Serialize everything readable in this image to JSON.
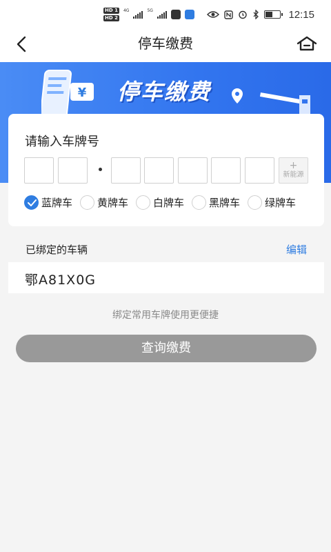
{
  "status_bar": {
    "sim1": "HD 1",
    "sim2": "HD 2",
    "net1": "4G",
    "net2": "5G",
    "time": "12:15",
    "battery_level_percent": 50,
    "icons": [
      "eye-icon",
      "nfc-icon",
      "alarm-icon",
      "bluetooth-icon",
      "battery-icon"
    ]
  },
  "nav": {
    "title": "停车缴费",
    "back_icon": "chevron-left-icon",
    "home_icon": "home-icon"
  },
  "banner": {
    "title": "停车缴费",
    "currency_symbol": "¥"
  },
  "plate_input": {
    "title": "请输入车牌号",
    "new_energy_plus": "+",
    "new_energy_label": "新能源",
    "plate_colors": [
      {
        "label": "蓝牌车",
        "selected": true
      },
      {
        "label": "黄牌车",
        "selected": false
      },
      {
        "label": "白牌车",
        "selected": false
      },
      {
        "label": "黑牌车",
        "selected": false
      },
      {
        "label": "绿牌车",
        "selected": false
      }
    ]
  },
  "bound": {
    "title": "已绑定的车辆",
    "edit_label": "编辑",
    "vehicles": [
      "鄂A81X0G"
    ]
  },
  "hint": "绑定常用车牌使用更便捷",
  "query_button": "查询缴费",
  "colors": {
    "accent": "#2f7de1",
    "banner": "#3275ef",
    "button_disabled": "#999999",
    "background": "#f4f4f4"
  }
}
